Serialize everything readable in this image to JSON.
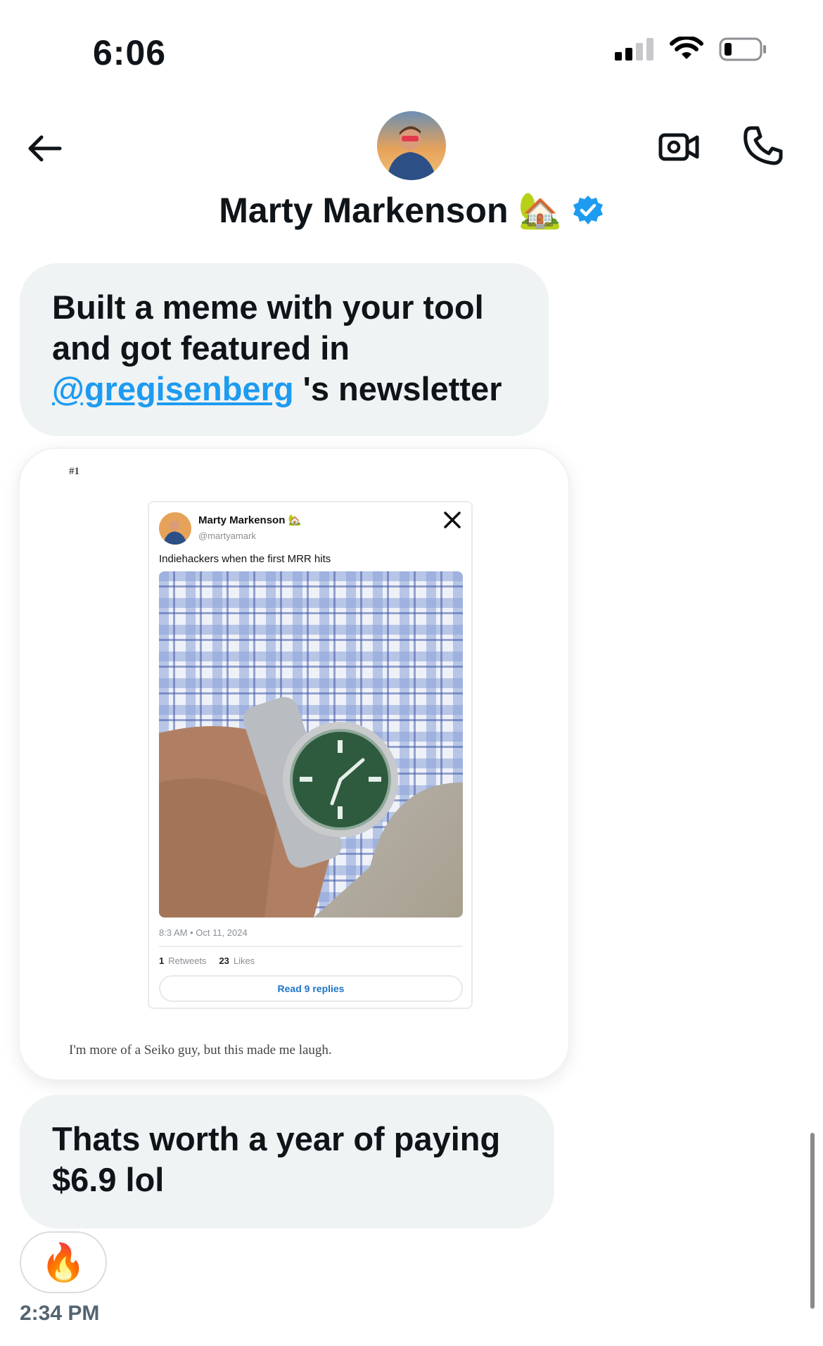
{
  "status_bar": {
    "time": "6:06",
    "icons": [
      "cellular-signal-icon",
      "wifi-icon",
      "battery-icon"
    ]
  },
  "header": {
    "back_icon": "arrow-left-icon",
    "contact_name": "Marty Markenson",
    "name_emoji": "🏡",
    "verified_icon": "verified-badge-icon",
    "video_icon": "video-camera-icon",
    "call_icon": "phone-icon"
  },
  "messages": [
    {
      "text_before": "Built a meme with your tool and got featured in ",
      "mention": "@gregisenberg",
      "text_after": " 's newsletter"
    },
    {
      "text": "Thats worth a year of paying $6.9 lol"
    }
  ],
  "image_card": {
    "number": "#1",
    "tweet": {
      "name": "Marty Markenson",
      "name_emoji": "🏡",
      "handle": "@martyamark",
      "text": "Indiehackers when the first MRR hits",
      "date": "8:3 AM • Oct 11, 2024",
      "retweets_count": "1",
      "retweets_label": "Retweets",
      "likes_count": "23",
      "likes_label": "Likes",
      "replies_button": "Read 9 replies"
    },
    "caption": "I'm more of a Seiko guy, but this made me laugh."
  },
  "reaction": {
    "emoji": "🔥"
  },
  "timestamp": "2:34 PM",
  "colors": {
    "bubble_bg": "#eff3f4",
    "mention": "#1d9bf0",
    "verified": "#1d9bf0",
    "timestamp": "#536471"
  }
}
